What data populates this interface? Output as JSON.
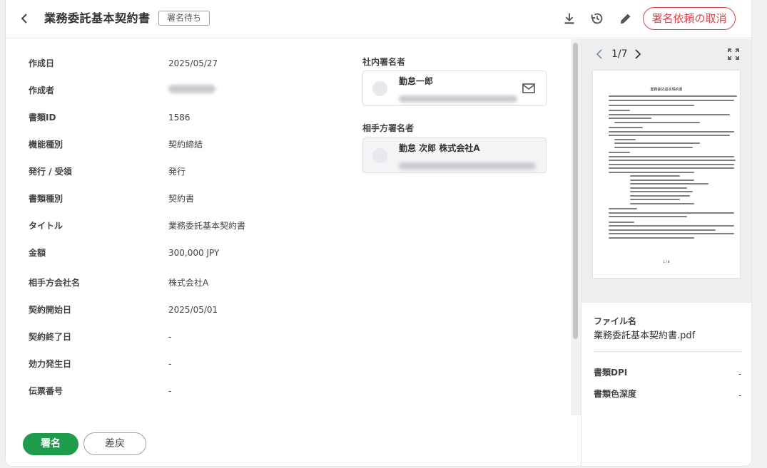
{
  "header": {
    "back_icon": "chevron-left-icon",
    "title": "業務委託基本契約書",
    "status": "署名待ち",
    "download_icon": "download-icon",
    "history_icon": "history-icon",
    "edit_icon": "pencil-icon",
    "cancel_label": "署名依頼の取消"
  },
  "details": [
    {
      "label": "作成日",
      "value": "2025/05/27"
    },
    {
      "label": "作成者",
      "value": ""
    },
    {
      "label": "書類ID",
      "value": "1586"
    },
    {
      "label": "機能種別",
      "value": "契約締結"
    },
    {
      "label": "発行 / 受領",
      "value": "発行"
    },
    {
      "label": "書類種別",
      "value": "契約書"
    },
    {
      "label": "タイトル",
      "value": "業務委託基本契約書"
    },
    {
      "label": "金額",
      "value": "300,000 JPY"
    },
    {
      "label": "相手方会社名",
      "value": "株式会社A"
    },
    {
      "label": "契約開始日",
      "value": "2025/05/01"
    },
    {
      "label": "契約終了日",
      "value": "-"
    },
    {
      "label": "効力発生日",
      "value": "-"
    },
    {
      "label": "伝票番号",
      "value": "-"
    }
  ],
  "signers": {
    "internal_heading": "社内署名者",
    "internal_name": "勤怠一郎",
    "counterparty_heading": "相手方署名者",
    "counterparty_name": "勤怠 次郎 株式会社A"
  },
  "footer": {
    "sign_label": "署名",
    "return_label": "差戻"
  },
  "preview": {
    "page_indicator": "1/7",
    "doc_heading": "業務委託基本契約書",
    "page_footer": "1 / 8"
  },
  "file_info": {
    "filename_label": "ファイル名",
    "filename": "業務委託基本契約書.pdf",
    "dpi_label": "書類DPI",
    "dpi_value": "-",
    "depth_label": "書類色深度",
    "depth_value": "-"
  },
  "colors": {
    "accent_green": "#1f9b4c",
    "danger_red": "#d9454d"
  }
}
